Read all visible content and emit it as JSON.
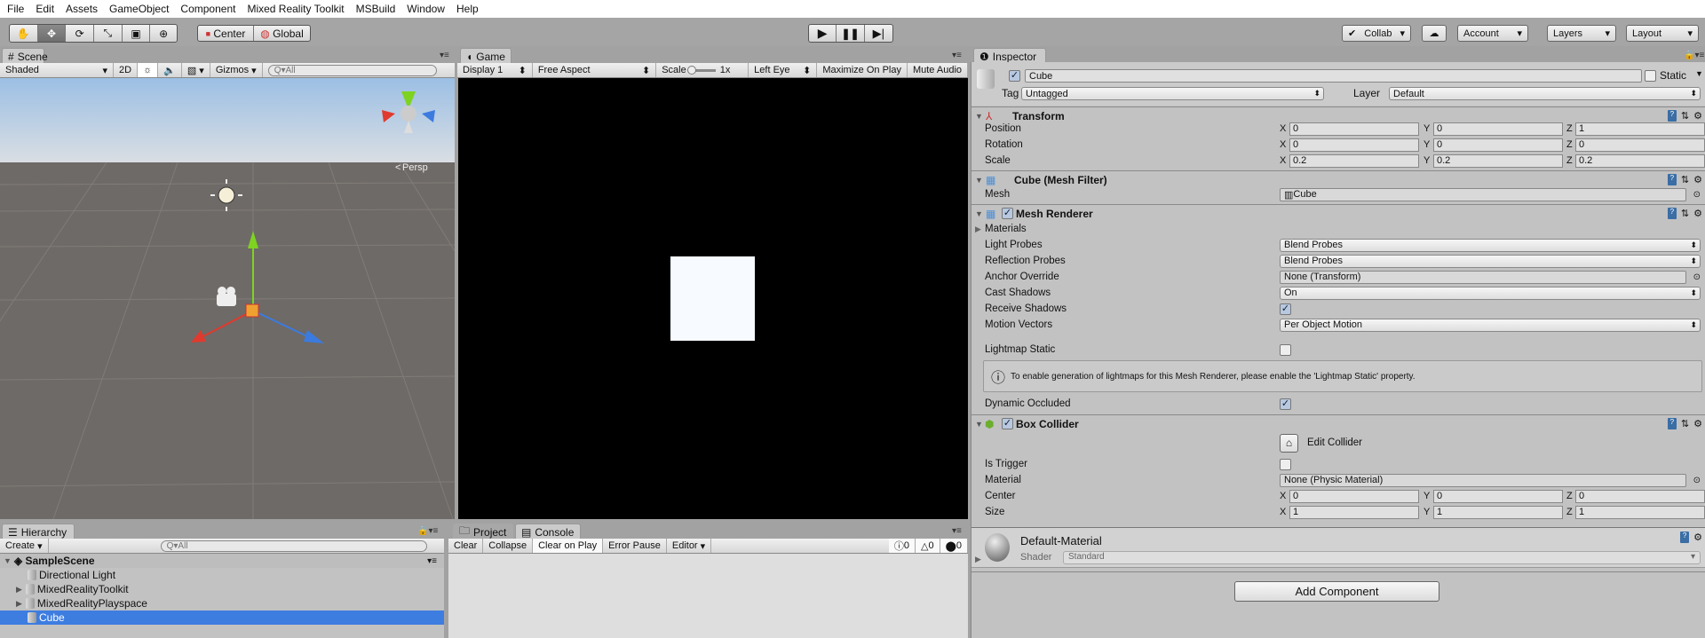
{
  "menu": [
    "File",
    "Edit",
    "Assets",
    "GameObject",
    "Component",
    "Mixed Reality Toolkit",
    "MSBuild",
    "Window",
    "Help"
  ],
  "toolbar": {
    "pivot": "Center",
    "space": "Global",
    "collab": "Collab",
    "account": "Account",
    "layers": "Layers",
    "layout": "Layout"
  },
  "scene": {
    "tab": "Scene",
    "shading": "Shaded",
    "mode2d": "2D",
    "gizmos": "Gizmos",
    "search_placeholder": "All",
    "persp": "Persp"
  },
  "game": {
    "tab": "Game",
    "display": "Display 1",
    "aspect": "Free Aspect",
    "scale_label": "Scale",
    "scale_value": "1x",
    "eye": "Left Eye",
    "maximize": "Maximize On Play",
    "mute": "Mute Audio"
  },
  "hierarchy": {
    "tab": "Hierarchy",
    "create": "Create",
    "search_placeholder": "All",
    "scene": "SampleScene",
    "items": [
      "Directional Light",
      "MixedRealityToolkit",
      "MixedRealityPlayspace",
      "Cube"
    ],
    "selected": "Cube"
  },
  "console": {
    "tab_project": "Project",
    "tab_console": "Console",
    "clear": "Clear",
    "collapse": "Collapse",
    "clear_on_play": "Clear on Play",
    "error_pause": "Error Pause",
    "editor": "Editor",
    "info_count": "0",
    "warn_count": "0",
    "error_count": "0"
  },
  "inspector": {
    "tab": "Inspector",
    "object_name": "Cube",
    "static_label": "Static",
    "tag_label": "Tag",
    "tag": "Untagged",
    "layer_label": "Layer",
    "layer": "Default",
    "transform": {
      "title": "Transform",
      "position_label": "Position",
      "rotation_label": "Rotation",
      "scale_label": "Scale",
      "position": [
        "0",
        "0",
        "1"
      ],
      "rotation": [
        "0",
        "0",
        "0"
      ],
      "scale": [
        "0.2",
        "0.2",
        "0.2"
      ]
    },
    "axes": [
      "X",
      "Y",
      "Z"
    ],
    "mesh_filter": {
      "title": "Cube (Mesh Filter)",
      "mesh_label": "Mesh",
      "mesh": "Cube"
    },
    "mesh_renderer": {
      "title": "Mesh Renderer",
      "materials": "Materials",
      "light_probes_label": "Light Probes",
      "light_probes": "Blend Probes",
      "reflection_label": "Reflection Probes",
      "reflection": "Blend Probes",
      "anchor_label": "Anchor Override",
      "anchor": "None (Transform)",
      "cast_label": "Cast Shadows",
      "cast": "On",
      "receive_label": "Receive Shadows",
      "motion_label": "Motion Vectors",
      "motion": "Per Object Motion",
      "lightmap_label": "Lightmap Static",
      "help": "To enable generation of lightmaps for this Mesh Renderer, please enable the 'Lightmap Static' property.",
      "dynamic_label": "Dynamic Occluded"
    },
    "box_collider": {
      "title": "Box Collider",
      "edit": "Edit Collider",
      "trigger_label": "Is Trigger",
      "material_label": "Material",
      "material": "None (Physic Material)",
      "center_label": "Center",
      "size_label": "Size",
      "center": [
        "0",
        "0",
        "0"
      ],
      "size": [
        "1",
        "1",
        "1"
      ]
    },
    "material": {
      "name": "Default-Material",
      "shader_label": "Shader",
      "shader": "Standard"
    },
    "add_component": "Add Component"
  }
}
